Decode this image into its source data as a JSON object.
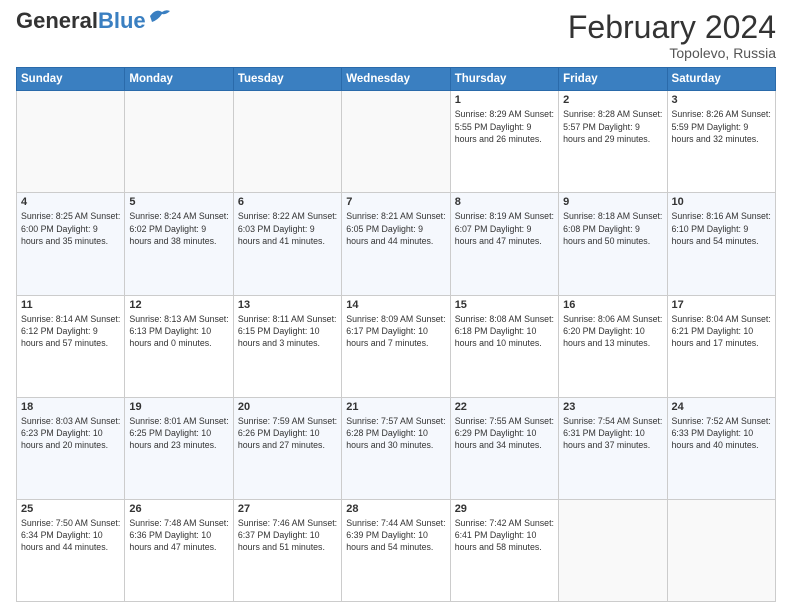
{
  "header": {
    "logo_general": "General",
    "logo_blue": "Blue",
    "title": "February 2024",
    "location": "Topolevo, Russia"
  },
  "days_of_week": [
    "Sunday",
    "Monday",
    "Tuesday",
    "Wednesday",
    "Thursday",
    "Friday",
    "Saturday"
  ],
  "weeks": [
    [
      {
        "day": "",
        "info": ""
      },
      {
        "day": "",
        "info": ""
      },
      {
        "day": "",
        "info": ""
      },
      {
        "day": "",
        "info": ""
      },
      {
        "day": "1",
        "info": "Sunrise: 8:29 AM\nSunset: 5:55 PM\nDaylight: 9 hours\nand 26 minutes."
      },
      {
        "day": "2",
        "info": "Sunrise: 8:28 AM\nSunset: 5:57 PM\nDaylight: 9 hours\nand 29 minutes."
      },
      {
        "day": "3",
        "info": "Sunrise: 8:26 AM\nSunset: 5:59 PM\nDaylight: 9 hours\nand 32 minutes."
      }
    ],
    [
      {
        "day": "4",
        "info": "Sunrise: 8:25 AM\nSunset: 6:00 PM\nDaylight: 9 hours\nand 35 minutes."
      },
      {
        "day": "5",
        "info": "Sunrise: 8:24 AM\nSunset: 6:02 PM\nDaylight: 9 hours\nand 38 minutes."
      },
      {
        "day": "6",
        "info": "Sunrise: 8:22 AM\nSunset: 6:03 PM\nDaylight: 9 hours\nand 41 minutes."
      },
      {
        "day": "7",
        "info": "Sunrise: 8:21 AM\nSunset: 6:05 PM\nDaylight: 9 hours\nand 44 minutes."
      },
      {
        "day": "8",
        "info": "Sunrise: 8:19 AM\nSunset: 6:07 PM\nDaylight: 9 hours\nand 47 minutes."
      },
      {
        "day": "9",
        "info": "Sunrise: 8:18 AM\nSunset: 6:08 PM\nDaylight: 9 hours\nand 50 minutes."
      },
      {
        "day": "10",
        "info": "Sunrise: 8:16 AM\nSunset: 6:10 PM\nDaylight: 9 hours\nand 54 minutes."
      }
    ],
    [
      {
        "day": "11",
        "info": "Sunrise: 8:14 AM\nSunset: 6:12 PM\nDaylight: 9 hours\nand 57 minutes."
      },
      {
        "day": "12",
        "info": "Sunrise: 8:13 AM\nSunset: 6:13 PM\nDaylight: 10 hours\nand 0 minutes."
      },
      {
        "day": "13",
        "info": "Sunrise: 8:11 AM\nSunset: 6:15 PM\nDaylight: 10 hours\nand 3 minutes."
      },
      {
        "day": "14",
        "info": "Sunrise: 8:09 AM\nSunset: 6:17 PM\nDaylight: 10 hours\nand 7 minutes."
      },
      {
        "day": "15",
        "info": "Sunrise: 8:08 AM\nSunset: 6:18 PM\nDaylight: 10 hours\nand 10 minutes."
      },
      {
        "day": "16",
        "info": "Sunrise: 8:06 AM\nSunset: 6:20 PM\nDaylight: 10 hours\nand 13 minutes."
      },
      {
        "day": "17",
        "info": "Sunrise: 8:04 AM\nSunset: 6:21 PM\nDaylight: 10 hours\nand 17 minutes."
      }
    ],
    [
      {
        "day": "18",
        "info": "Sunrise: 8:03 AM\nSunset: 6:23 PM\nDaylight: 10 hours\nand 20 minutes."
      },
      {
        "day": "19",
        "info": "Sunrise: 8:01 AM\nSunset: 6:25 PM\nDaylight: 10 hours\nand 23 minutes."
      },
      {
        "day": "20",
        "info": "Sunrise: 7:59 AM\nSunset: 6:26 PM\nDaylight: 10 hours\nand 27 minutes."
      },
      {
        "day": "21",
        "info": "Sunrise: 7:57 AM\nSunset: 6:28 PM\nDaylight: 10 hours\nand 30 minutes."
      },
      {
        "day": "22",
        "info": "Sunrise: 7:55 AM\nSunset: 6:29 PM\nDaylight: 10 hours\nand 34 minutes."
      },
      {
        "day": "23",
        "info": "Sunrise: 7:54 AM\nSunset: 6:31 PM\nDaylight: 10 hours\nand 37 minutes."
      },
      {
        "day": "24",
        "info": "Sunrise: 7:52 AM\nSunset: 6:33 PM\nDaylight: 10 hours\nand 40 minutes."
      }
    ],
    [
      {
        "day": "25",
        "info": "Sunrise: 7:50 AM\nSunset: 6:34 PM\nDaylight: 10 hours\nand 44 minutes."
      },
      {
        "day": "26",
        "info": "Sunrise: 7:48 AM\nSunset: 6:36 PM\nDaylight: 10 hours\nand 47 minutes."
      },
      {
        "day": "27",
        "info": "Sunrise: 7:46 AM\nSunset: 6:37 PM\nDaylight: 10 hours\nand 51 minutes."
      },
      {
        "day": "28",
        "info": "Sunrise: 7:44 AM\nSunset: 6:39 PM\nDaylight: 10 hours\nand 54 minutes."
      },
      {
        "day": "29",
        "info": "Sunrise: 7:42 AM\nSunset: 6:41 PM\nDaylight: 10 hours\nand 58 minutes."
      },
      {
        "day": "",
        "info": ""
      },
      {
        "day": "",
        "info": ""
      }
    ]
  ]
}
